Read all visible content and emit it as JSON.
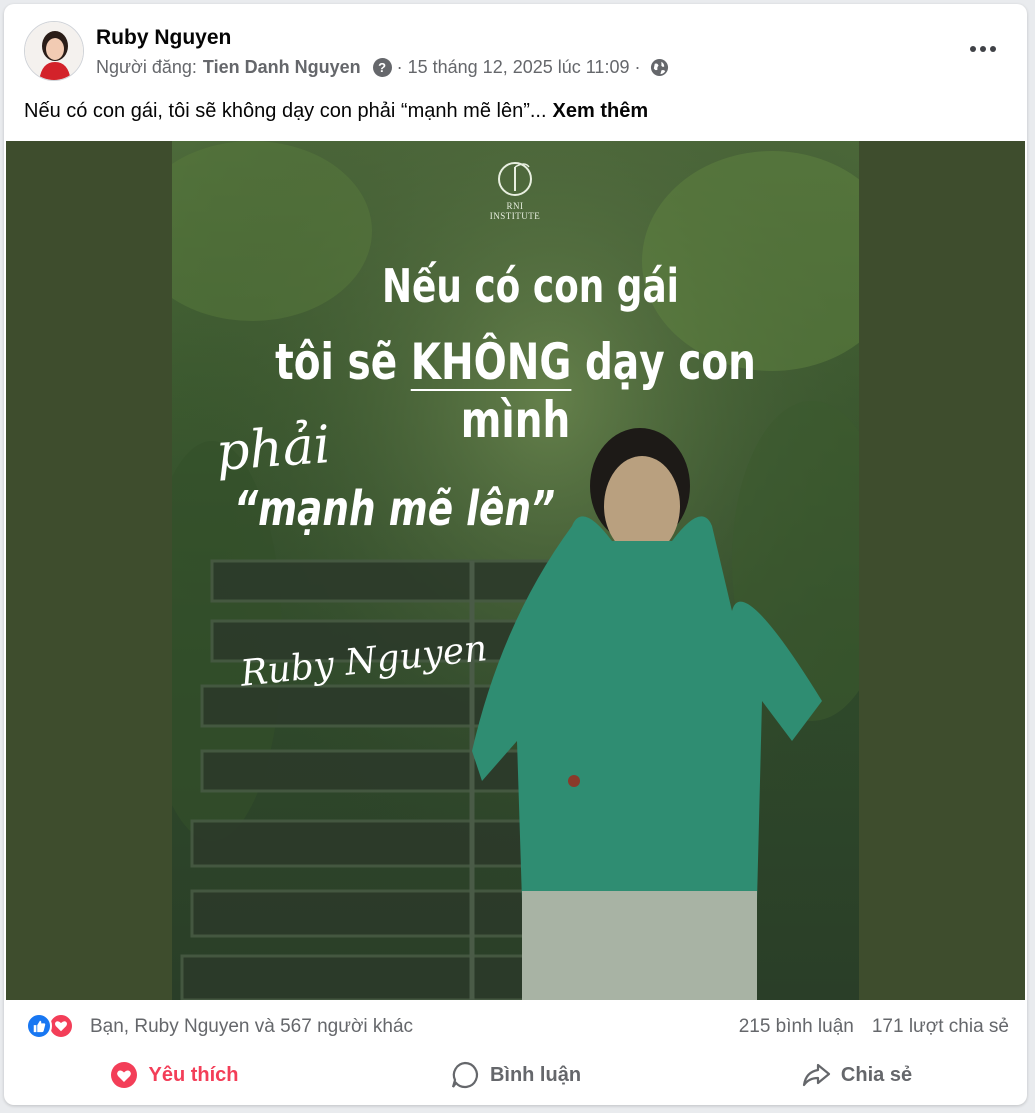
{
  "post": {
    "author": "Ruby Nguyen",
    "poster_prefix": "Người đăng:",
    "poster_name": "Tien Danh Nguyen",
    "date": "15 tháng 12, 2025 lúc 11:09",
    "separator": "·",
    "help_icon_glyph": "?",
    "text": "Nếu có con gái, tôi sẽ không dạy con phải “mạnh mẽ lên”...",
    "see_more": "Xem thêm"
  },
  "image": {
    "logo_text": "RNI INSTITUTE",
    "line1": "Nếu có con gái",
    "line2_pre": "tôi sẽ ",
    "line2_emph": "KHÔNG",
    "line2_post": " dạy con mình",
    "line3": "phải",
    "line4": "“mạnh mẽ lên”",
    "signature": "Ruby Nguyen"
  },
  "stats": {
    "reactions_text": "Bạn, Ruby Nguyen và 567 người khác",
    "comments": "215 bình luận",
    "shares": "171 lượt chia sẻ"
  },
  "actions": {
    "like": "Yêu thích",
    "comment": "Bình luận",
    "share": "Chia sẻ"
  },
  "colors": {
    "media_bg": "#3e4d2d",
    "love": "#f33e58",
    "like": "#1877f2",
    "muted_text": "#65676b"
  },
  "icons": [
    "help-icon",
    "globe-icon",
    "more-icon",
    "like-reaction-icon",
    "love-reaction-icon",
    "heart-icon",
    "comment-icon",
    "share-icon"
  ]
}
